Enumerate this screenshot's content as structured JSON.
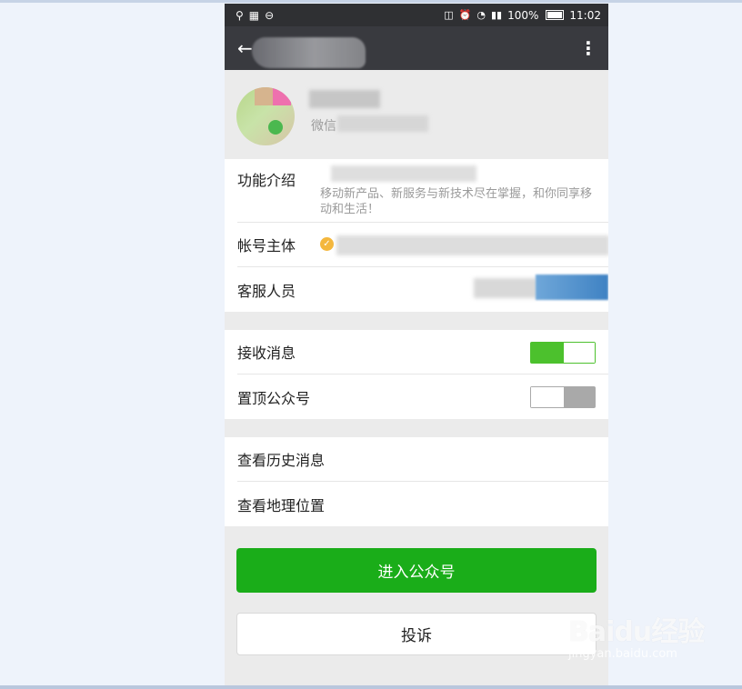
{
  "status_bar": {
    "battery_text": "100%",
    "time": "11:02",
    "left_icons": [
      "usb-icon",
      "grid-icon",
      "minus-circle-icon"
    ],
    "right_icons": [
      "silent-icon",
      "alarm-icon",
      "wifi-icon",
      "signal-icon",
      "battery-icon"
    ]
  },
  "profile": {
    "subtitle_prefix": "微信"
  },
  "info_rows": {
    "function_intro_label": "功能介绍",
    "function_intro_text": "移动新产品、新服务与新技术尽在掌握，和你同享移动和生活！",
    "account_entity_label": "帐号主体",
    "customer_service_label": "客服人员"
  },
  "settings": {
    "receive_messages_label": "接收消息",
    "receive_messages_on": true,
    "pin_official_account_label": "置顶公众号",
    "pin_official_account_on": false
  },
  "links": {
    "history_label": "查看历史消息",
    "location_label": "查看地理位置"
  },
  "actions": {
    "enter_label": "进入公众号",
    "report_label": "投诉"
  },
  "colors": {
    "accent_green": "#1aad19",
    "toggle_green": "#4cc12d",
    "top_bar": "#393a3f"
  },
  "watermark": {
    "brand_text": "Baidu经验",
    "url_text": "jingyan.baidu.com"
  }
}
